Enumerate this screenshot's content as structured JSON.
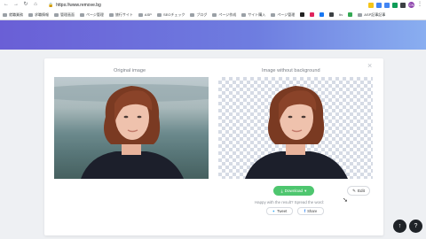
{
  "browser": {
    "url": "https://www.remove.bg",
    "back_glyph": "←",
    "forward_glyph": "→",
    "reload_glyph": "↻",
    "home_glyph": "⌂",
    "profile": "CN"
  },
  "bookmarks": [
    {
      "label": "就職業務",
      "type": "folder"
    },
    {
      "label": "求職情報",
      "type": "folder"
    },
    {
      "label": "管理画面",
      "type": "folder"
    },
    {
      "label": "ページ管理",
      "type": "folder"
    },
    {
      "label": "旅行サイト",
      "type": "folder"
    },
    {
      "label": "ASP",
      "type": "folder"
    },
    {
      "label": "SEOチェック",
      "type": "folder"
    },
    {
      "label": "ブログ",
      "type": "folder"
    },
    {
      "label": "ページ作成",
      "type": "folder"
    },
    {
      "label": "サイト購入",
      "type": "folder"
    },
    {
      "label": "ページ管理",
      "type": "folder"
    },
    {
      "label": "",
      "type": "favicon",
      "color": "#222222"
    },
    {
      "label": "",
      "type": "favicon",
      "color": "#e0245e"
    },
    {
      "label": "",
      "type": "favicon",
      "color": "#1877f2"
    },
    {
      "label": "",
      "type": "favicon",
      "color": "#3c4043"
    },
    {
      "label": "tiv",
      "type": "text"
    },
    {
      "label": "",
      "type": "favicon",
      "color": "#34a853"
    },
    {
      "label": "ASP記事記事",
      "type": "folder"
    }
  ],
  "card": {
    "original_label": "Original image",
    "nobg_label": "Image without background",
    "close_glyph": "×",
    "download_label": "Download",
    "download_icon": "download-icon",
    "edit_label": "Edit",
    "edit_icon": "pencil-icon",
    "happy_text": "Happy with the result? Spread the word:",
    "tweet_label": "Tweet",
    "share_label": "Share"
  },
  "fabs": {
    "up_glyph": "↑",
    "help_glyph": "?"
  },
  "colors": {
    "accent_green": "#4ec66f",
    "hero_start": "#6a5fd6",
    "hero_end": "#89aef0"
  }
}
